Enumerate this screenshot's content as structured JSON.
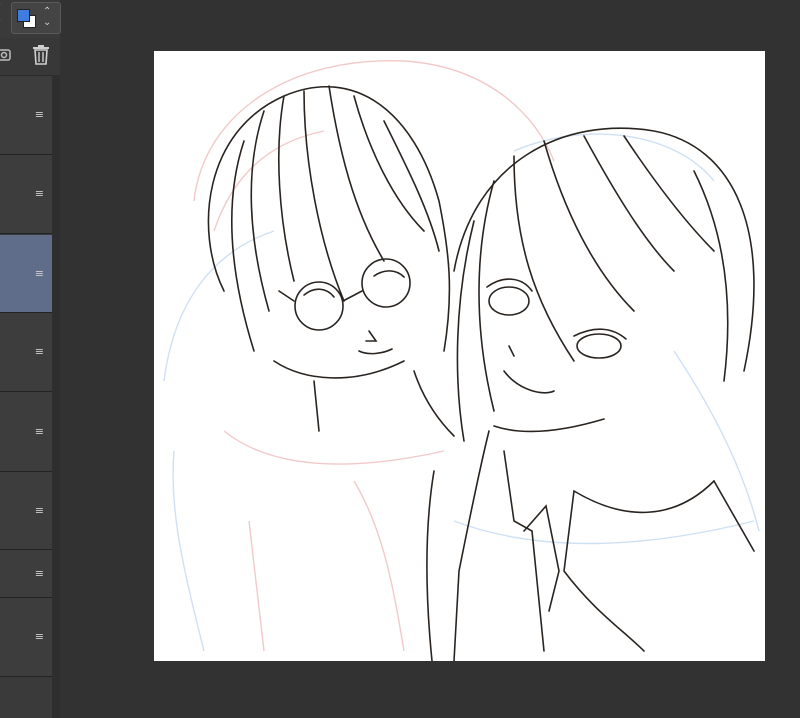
{
  "toolbar": {
    "stepper_arrows": "⌃⌄",
    "colors": {
      "foreground": "#3f7de0",
      "background": "#ffffff"
    }
  },
  "icons": {
    "color_stepper": "chevron-up-down-icon",
    "left_stepper": "chevron-up-down-icon",
    "new_folder": "new-folder-icon",
    "delete": "trash-icon",
    "row_handle": "drag-handle-icon"
  },
  "layers": [
    {
      "handle": "≡",
      "selected": false
    },
    {
      "handle": "≡",
      "selected": false
    },
    {
      "handle": "≡",
      "selected": true
    },
    {
      "handle": "≡",
      "selected": false
    },
    {
      "handle": "≡",
      "selected": false
    },
    {
      "handle": "≡",
      "selected": false
    },
    {
      "handle": "≡",
      "selected": false
    },
    {
      "handle": "≡",
      "selected": false
    }
  ],
  "canvas": {
    "background": "#ffffff",
    "ink": "#2a2420"
  }
}
